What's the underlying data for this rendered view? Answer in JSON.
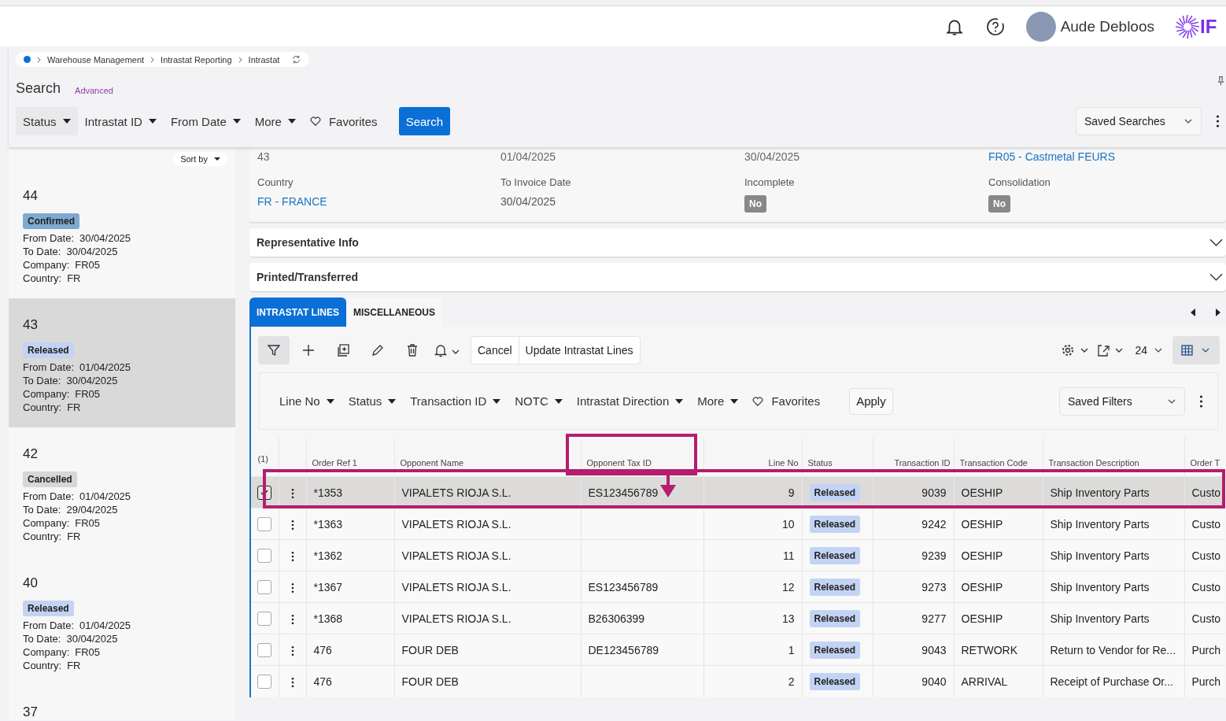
{
  "header": {
    "user_name": "Aude Debloos",
    "logo_text": "IF"
  },
  "breadcrumbs": [
    "Warehouse Management",
    "Intrastat Reporting",
    "Intrastat"
  ],
  "search": {
    "title": "Search",
    "advanced_link": "Advanced",
    "filters": [
      "Status",
      "Intrastat ID",
      "From Date",
      "More"
    ],
    "favorites": "Favorites",
    "button": "Search",
    "saved_searches": "Saved Searches"
  },
  "list": {
    "sort_label": "Sort by",
    "items": [
      {
        "number": "44",
        "status": "Confirmed",
        "color": "#7eaacf",
        "selected": false,
        "fields": [
          {
            "label": "From Date:",
            "value": "30/04/2025"
          },
          {
            "label": "To Date:",
            "value": "30/04/2025"
          },
          {
            "label": "Company:",
            "value": "FR05"
          },
          {
            "label": "Country:",
            "value": "FR"
          }
        ]
      },
      {
        "number": "43",
        "status": "Released",
        "color": "#c3d3f3",
        "selected": true,
        "fields": [
          {
            "label": "From Date:",
            "value": "01/04/2025"
          },
          {
            "label": "To Date:",
            "value": "30/04/2025"
          },
          {
            "label": "Company:",
            "value": "FR05"
          },
          {
            "label": "Country:",
            "value": "FR"
          }
        ]
      },
      {
        "number": "42",
        "status": "Cancelled",
        "color": "#d6d6d6",
        "selected": false,
        "fields": [
          {
            "label": "From Date:",
            "value": "01/04/2025"
          },
          {
            "label": "To Date:",
            "value": "29/04/2025"
          },
          {
            "label": "Company:",
            "value": "FR05"
          },
          {
            "label": "Country:",
            "value": "FR"
          }
        ]
      },
      {
        "number": "40",
        "status": "Released",
        "color": "#c3d3f3",
        "selected": false,
        "fields": [
          {
            "label": "From Date:",
            "value": "01/04/2025"
          },
          {
            "label": "To Date:",
            "value": "30/04/2025"
          },
          {
            "label": "Company:",
            "value": "FR05"
          },
          {
            "label": "Country:",
            "value": "FR"
          }
        ]
      },
      {
        "number": "37",
        "selected": false
      }
    ]
  },
  "details": {
    "top_values": [
      {
        "value": "43",
        "kind": "text"
      },
      {
        "value": "01/04/2025",
        "kind": "text"
      },
      {
        "value": "30/04/2025",
        "kind": "text"
      },
      {
        "value": "FR05 - Castmetal  FEURS",
        "kind": "link"
      }
    ],
    "fields": [
      {
        "label": "Country",
        "value": "FR - FRANCE",
        "kind": "link"
      },
      {
        "label": "To Invoice Date",
        "value": "30/04/2025",
        "kind": "text"
      },
      {
        "label": "Incomplete",
        "value": "No",
        "kind": "badge"
      },
      {
        "label": "Consolidation",
        "value": "No",
        "kind": "badge"
      }
    ]
  },
  "sections": [
    {
      "title": "Representative Info",
      "expanded": false
    },
    {
      "title": "Printed/Transferred",
      "expanded": false
    }
  ],
  "tabs": [
    {
      "label": "INTRASTAT LINES",
      "selected": true
    },
    {
      "label": "MISCELLANEOUS",
      "selected": false
    }
  ],
  "toolbar": {
    "buttons": [
      "Cancel",
      "Update Intrastat Lines"
    ],
    "page_size": "24"
  },
  "filter_bar": {
    "filters": [
      "Line No",
      "Status",
      "Transaction ID",
      "NOTC",
      "Intrastat Direction",
      "More"
    ],
    "favorites": "Favorites",
    "apply": "Apply",
    "saved_filters": "Saved Filters"
  },
  "table": {
    "selection_count": "(1)",
    "columns": [
      {
        "label": "Order Ref 1",
        "kind": "text"
      },
      {
        "label": "Opponent Name",
        "kind": "text"
      },
      {
        "label": "Opponent Tax ID",
        "kind": "text"
      },
      {
        "label": "Line No",
        "kind": "number"
      },
      {
        "label": "Status",
        "kind": "badge"
      },
      {
        "label": "Transaction ID",
        "kind": "number"
      },
      {
        "label": "Transaction Code",
        "kind": "text"
      },
      {
        "label": "Transaction Description",
        "kind": "text"
      },
      {
        "label": "Order T",
        "kind": "text"
      }
    ],
    "rows": [
      {
        "selected": true,
        "checked": true,
        "cells": [
          "*1353",
          "VIPALETS RIOJA S.L.",
          "ES123456789",
          "9",
          "Released",
          "9039",
          "OESHIP",
          "Ship Inventory Parts",
          "Custo"
        ]
      },
      {
        "selected": false,
        "checked": false,
        "cells": [
          "*1363",
          "VIPALETS RIOJA S.L.",
          "",
          "10",
          "Released",
          "9242",
          "OESHIP",
          "Ship Inventory Parts",
          "Custo"
        ]
      },
      {
        "selected": false,
        "checked": false,
        "cells": [
          "*1362",
          "VIPALETS RIOJA S.L.",
          "",
          "11",
          "Released",
          "9239",
          "OESHIP",
          "Ship Inventory Parts",
          "Custo"
        ]
      },
      {
        "selected": false,
        "checked": false,
        "cells": [
          "*1367",
          "VIPALETS RIOJA S.L.",
          "ES123456789",
          "12",
          "Released",
          "9273",
          "OESHIP",
          "Ship Inventory Parts",
          "Custo"
        ]
      },
      {
        "selected": false,
        "checked": false,
        "cells": [
          "*1368",
          "VIPALETS RIOJA S.L.",
          "B26306399",
          "13",
          "Released",
          "9277",
          "OESHIP",
          "Ship Inventory Parts",
          "Custo"
        ]
      },
      {
        "selected": false,
        "checked": false,
        "cells": [
          "476",
          "FOUR DEB",
          "DE123456789",
          "1",
          "Released",
          "9043",
          "RETWORK",
          "Return to Vendor for Re...",
          "Purch"
        ]
      },
      {
        "selected": false,
        "checked": false,
        "cells": [
          "476",
          "FOUR DEB",
          "",
          "2",
          "Released",
          "9040",
          "ARRIVAL",
          "Receipt of Purchase Or...",
          "Purch"
        ]
      }
    ]
  }
}
